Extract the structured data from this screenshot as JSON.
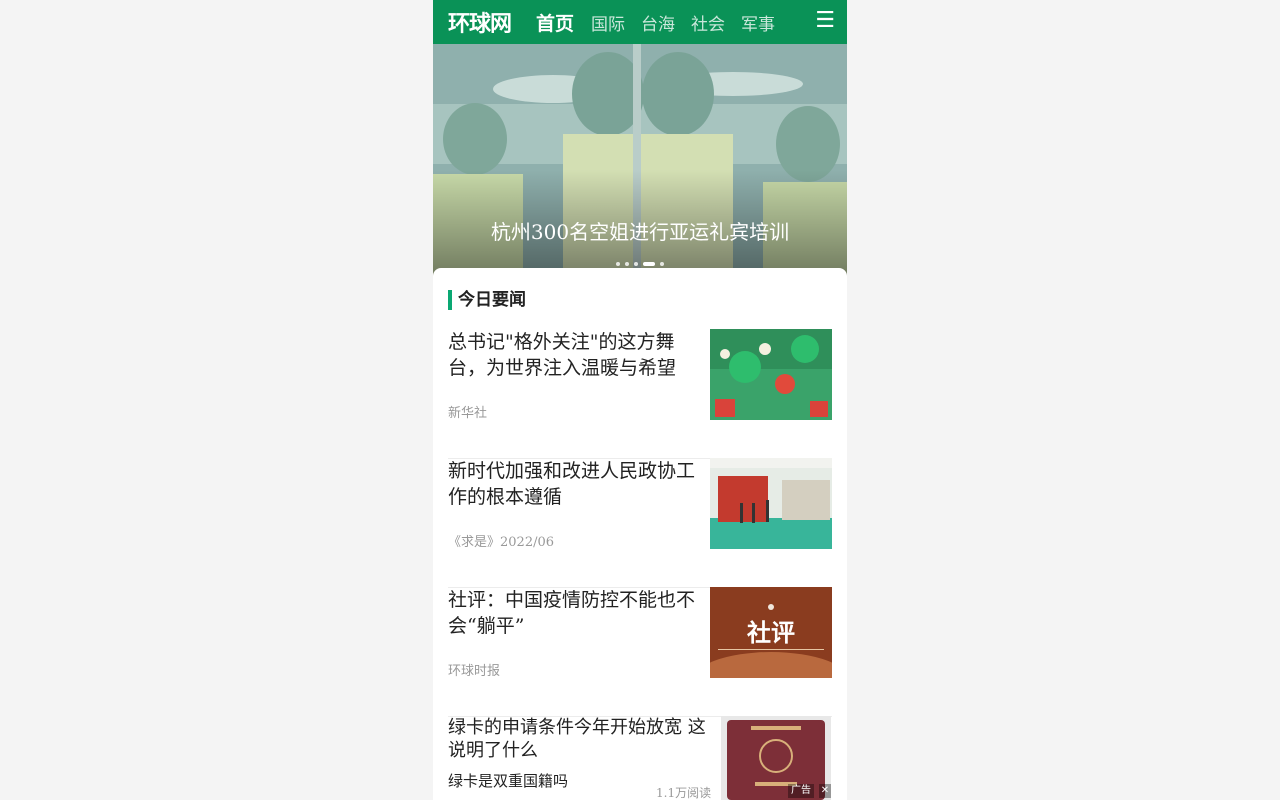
{
  "header": {
    "logo": "环球网",
    "nav": [
      {
        "label": "首页",
        "active": true
      },
      {
        "label": "国际",
        "active": false
      },
      {
        "label": "台海",
        "active": false
      },
      {
        "label": "社会",
        "active": false
      },
      {
        "label": "军事",
        "active": false
      }
    ],
    "menu_icon": "hamburger-menu-icon",
    "color": "#0a9257"
  },
  "hero": {
    "caption": "杭州300名空姐进行亚运礼宾培训",
    "slide_count": 5,
    "active_slide": 4
  },
  "section": {
    "title": "今日要闻",
    "accent": "#0aa873"
  },
  "news": [
    {
      "title": "总书记\"格外关注\"的这方舞台，为世界注入温暖与希望",
      "source": "新华社"
    },
    {
      "title": "新时代加强和改进人民政协工作的根本遵循",
      "source": "《求是》2022/06"
    },
    {
      "title": "社评：中国疫情防控不能也不会“躺平”",
      "source": "环球时报",
      "thumb_text": "社评"
    }
  ],
  "ad": {
    "title": "绿卡的申请条件今年开始放宽 这说明了什么",
    "subtitle": "绿卡是双重国籍吗",
    "reads": "1.1万阅读",
    "badge": "广告",
    "close": "✕"
  }
}
